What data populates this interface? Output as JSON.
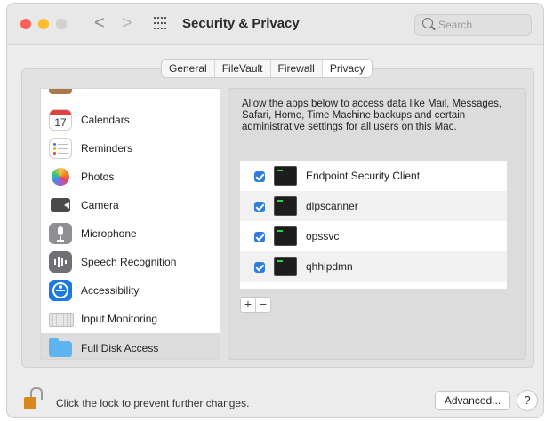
{
  "window": {
    "title": "Security & Privacy",
    "traffic_lights": {
      "close_color": "#ff5f57",
      "minimize_color": "#febc2e",
      "zoom_color": "#d0d0d0"
    },
    "nav_back": "<",
    "nav_forward": ">"
  },
  "search": {
    "placeholder": "Search"
  },
  "tabs": [
    {
      "label": "General",
      "active": false
    },
    {
      "label": "FileVault",
      "active": false
    },
    {
      "label": "Firewall",
      "active": false
    },
    {
      "label": "Privacy",
      "active": true
    }
  ],
  "sidebar": {
    "items": [
      {
        "label": "Calendars",
        "icon": "calendar-icon",
        "icon_text": "17"
      },
      {
        "label": "Reminders",
        "icon": "reminders-icon"
      },
      {
        "label": "Photos",
        "icon": "photos-icon"
      },
      {
        "label": "Camera",
        "icon": "camera-icon"
      },
      {
        "label": "Microphone",
        "icon": "microphone-icon"
      },
      {
        "label": "Speech Recognition",
        "icon": "speech-recognition-icon"
      },
      {
        "label": "Accessibility",
        "icon": "accessibility-icon"
      },
      {
        "label": "Input Monitoring",
        "icon": "keyboard-icon"
      },
      {
        "label": "Full Disk Access",
        "icon": "folder-icon",
        "selected": true
      }
    ]
  },
  "main": {
    "description": "Allow the apps below to access data like Mail, Messages, Safari, Home, Time Machine backups and certain administrative settings for all users on this Mac.",
    "apps": [
      {
        "name": "Endpoint Security Client",
        "checked": true,
        "icon": "terminal-icon"
      },
      {
        "name": "dlpscanner",
        "checked": true,
        "icon": "terminal-icon"
      },
      {
        "name": "opssvc",
        "checked": true,
        "icon": "terminal-icon"
      },
      {
        "name": "qhhlpdmn",
        "checked": true,
        "icon": "terminal-icon"
      }
    ],
    "add_label": "+",
    "remove_label": "−"
  },
  "footer": {
    "lock_text": "Click the lock to prevent further changes.",
    "advanced_label": "Advanced...",
    "help_label": "?"
  },
  "colors": {
    "accent": "#2f7de1",
    "selection": "#dcdcdc"
  }
}
